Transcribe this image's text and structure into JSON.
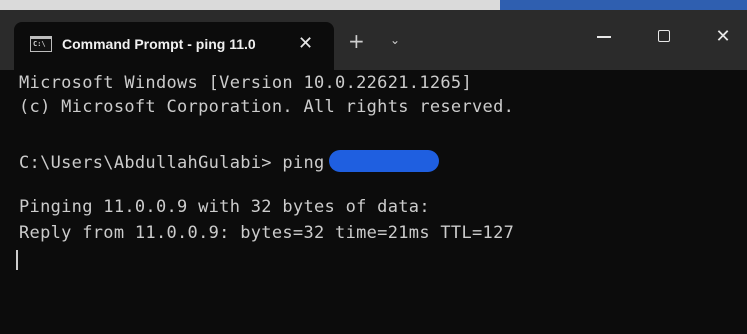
{
  "window": {
    "tab_title": "Command Prompt - ping 11.0",
    "tab_icon_text": "C:\\"
  },
  "controls": {
    "close_tab": "✕",
    "new_tab": "+",
    "dropdown": "⌄",
    "minimize": "—",
    "maximize": "☐",
    "close": "✕"
  },
  "terminal": {
    "lines": [
      "Microsoft Windows [Version 10.0.22621.1265]",
      "(c) Microsoft Corporation. All rights reserved.",
      "C:\\Users\\AbdullahGulabi> ping",
      "Pinging 11.0.0.9 with 32 bytes of data:",
      "Reply from 11.0.0.9: bytes=32 time=21ms TTL=127"
    ]
  },
  "colors": {
    "background": "#0c0c0c",
    "text": "#cccccc",
    "titlebar": "#2b2b2b",
    "redaction": "#1f5fe0"
  }
}
